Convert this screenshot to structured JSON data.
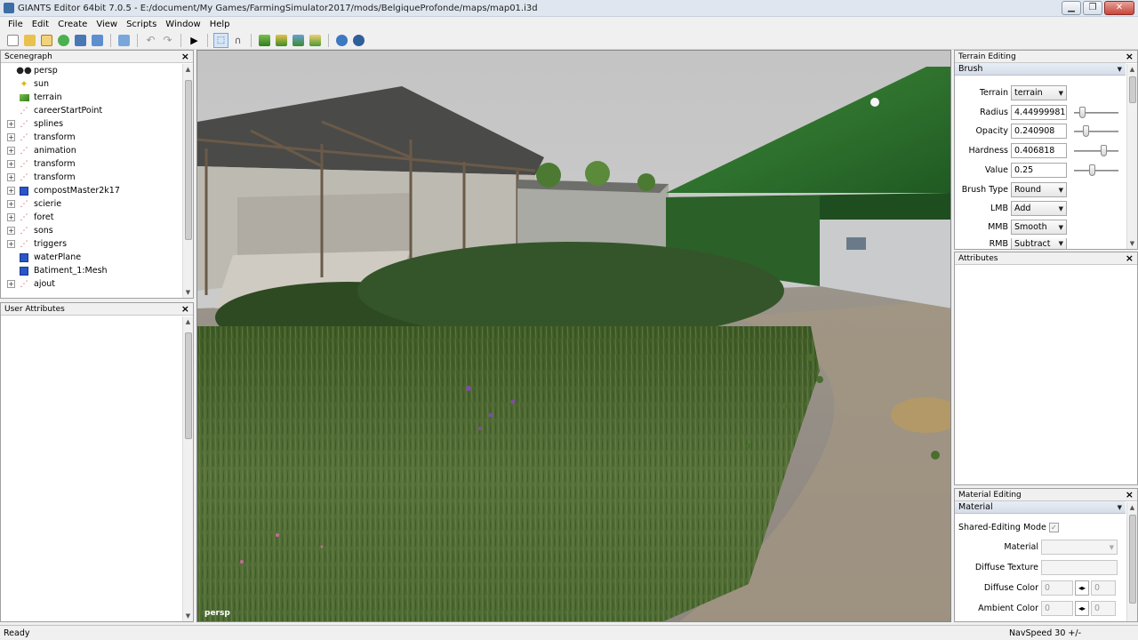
{
  "window": {
    "title": "GIANTS Editor 64bit 7.0.5 - E:/document/My Games/FarmingSimulator2017/mods/BelgiqueProfonde/maps/map01.i3d",
    "minimize": "▁",
    "maximize": "❐",
    "close": "✕"
  },
  "menu": [
    "File",
    "Edit",
    "Create",
    "View",
    "Scripts",
    "Window",
    "Help"
  ],
  "scenegraph": {
    "title": "Scenegraph",
    "items": [
      {
        "label": "persp",
        "icon": "camera-icon",
        "expandable": false
      },
      {
        "label": "sun",
        "icon": "light-icon",
        "expandable": false
      },
      {
        "label": "terrain",
        "icon": "terrain-icon",
        "expandable": false
      },
      {
        "label": "careerStartPoint",
        "icon": "transform-icon",
        "expandable": false
      },
      {
        "label": "splines",
        "icon": "transform-icon",
        "expandable": true
      },
      {
        "label": "transform",
        "icon": "transform-icon",
        "expandable": true
      },
      {
        "label": "animation",
        "icon": "transform-icon",
        "expandable": true
      },
      {
        "label": "transform",
        "icon": "transform-icon",
        "expandable": true
      },
      {
        "label": "transform",
        "icon": "transform-icon",
        "expandable": true
      },
      {
        "label": "compostMaster2k17",
        "icon": "mesh-icon",
        "expandable": true
      },
      {
        "label": "scierie",
        "icon": "transform-icon",
        "expandable": true
      },
      {
        "label": "foret",
        "icon": "transform-icon",
        "expandable": true
      },
      {
        "label": "sons",
        "icon": "transform-icon",
        "expandable": true
      },
      {
        "label": "triggers",
        "icon": "transform-icon",
        "expandable": true
      },
      {
        "label": "waterPlane",
        "icon": "mesh-icon",
        "expandable": false
      },
      {
        "label": "Batiment_1:Mesh",
        "icon": "mesh-icon",
        "expandable": false
      },
      {
        "label": "ajout",
        "icon": "transform-icon",
        "expandable": true
      }
    ]
  },
  "user_attributes": {
    "title": "User Attributes"
  },
  "viewport": {
    "camera_label": "persp"
  },
  "terrain_editing": {
    "title": "Terrain Editing",
    "section": "Brush",
    "terrain_label": "Terrain",
    "terrain_value": "terrain",
    "radius_label": "Radius",
    "radius_value": "4.44999981",
    "radius_level": 0.15,
    "opacity_label": "Opacity",
    "opacity_value": "0.240908",
    "opacity_level": 0.24,
    "hardness_label": "Hardness",
    "hardness_value": "0.406818",
    "hardness_level": 0.7,
    "value_label": "Value",
    "value_value": "0.25",
    "value_level": 0.4,
    "brush_type_label": "Brush Type",
    "brush_type_value": "Round",
    "lmb_label": "LMB",
    "lmb_value": "Add",
    "mmb_label": "MMB",
    "mmb_value": "Smooth",
    "rmb_label": "RMB",
    "rmb_value": "Subtract"
  },
  "attributes": {
    "title": "Attributes"
  },
  "material_editing": {
    "title": "Material Editing",
    "section": "Material",
    "shared_label": "Shared-Editing Mode",
    "shared_checked": "✓",
    "material_label": "Material",
    "material_value": "",
    "diffuse_texture_label": "Diffuse Texture",
    "diffuse_color_label": "Diffuse Color",
    "diffuse_color_value": "0",
    "diffuse_color_value2": "0",
    "ambient_color_label": "Ambient Color",
    "ambient_color_value": "0",
    "ambient_color_value2": "0"
  },
  "status": {
    "left": "Ready",
    "right": "NavSpeed 30 +/-"
  },
  "colors": {
    "accent": "#3a6ea5",
    "barn_green": "#2f6a2c",
    "grass": "#4a6a2e"
  }
}
